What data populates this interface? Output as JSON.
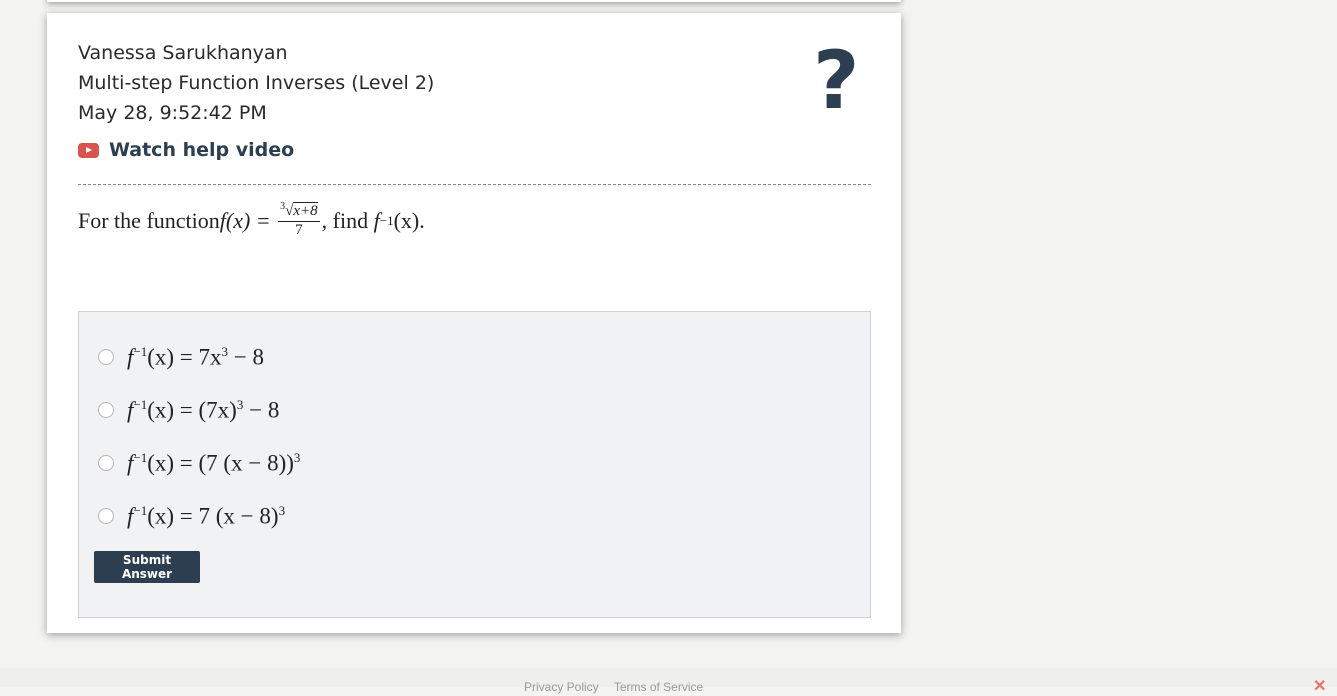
{
  "header": {
    "student_name": "Vanessa Sarukhanyan",
    "assignment": "Multi-step Function Inverses (Level 2)",
    "timestamp": "May 28, 9:52:42 PM",
    "help_icon": "?",
    "video_link_label": "Watch help video"
  },
  "question": {
    "prefix": "For the function ",
    "lhs": "f(x) = ",
    "root_index": "3",
    "radicand": "x+8",
    "denominator": "7",
    "mid": ", find ",
    "target": "f",
    "target_exp": "−1",
    "target_tail": "(x)."
  },
  "choices": [
    {
      "base": "f",
      "exp": "−1",
      "text": "(x) = 7x",
      "exp2": "3",
      "tail": " − 8"
    },
    {
      "base": "f",
      "exp": "−1",
      "text": "(x) = (7x)",
      "exp2": "3",
      "tail": " − 8"
    },
    {
      "base": "f",
      "exp": "−1",
      "text": "(x) = (7 (x − 8))",
      "exp2": "3",
      "tail": ""
    },
    {
      "base": "f",
      "exp": "−1",
      "text": "(x) = 7 (x − 8)",
      "exp2": "3",
      "tail": ""
    }
  ],
  "submit_label": "Submit Answer",
  "footer": {
    "privacy": "Privacy Policy",
    "terms": "Terms of Service",
    "close": "✕"
  },
  "icons": {
    "video": "youtube-play-icon",
    "help": "question-mark-icon",
    "close": "close-icon"
  },
  "colors": {
    "accent": "#2c3e50",
    "video_red": "#d9534f",
    "answer_bg": "#f1f2f4"
  }
}
